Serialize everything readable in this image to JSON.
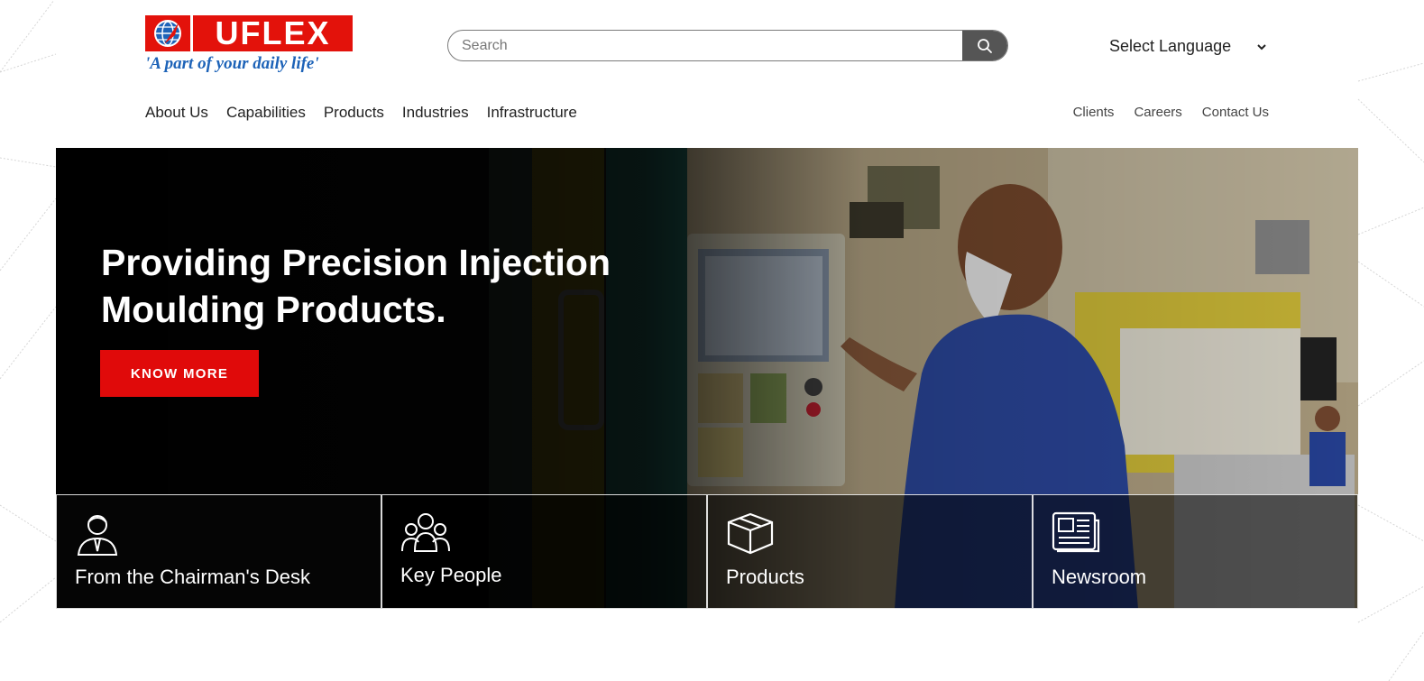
{
  "header": {
    "logo_text": "UFLEX",
    "logo_tagline": "'A part of your daily life'",
    "search_placeholder": "Search",
    "language_label": "Select Language",
    "language_chevron": "⌄"
  },
  "main_nav": [
    "About Us",
    "Capabilities",
    "Products",
    "Industries",
    "Infrastructure"
  ],
  "secondary_nav": [
    "Clients",
    "Careers",
    "Contact Us"
  ],
  "hero": {
    "title": "Providing Precision Injection Moulding Products.",
    "cta_label": "KNOW MORE"
  },
  "tiles": [
    {
      "label": "From the Chairman's Desk",
      "icon": "chairman-icon"
    },
    {
      "label": "Key People",
      "icon": "people-group-icon"
    },
    {
      "label": "Products",
      "icon": "box-icon"
    },
    {
      "label": "Newsroom",
      "icon": "newspaper-icon"
    }
  ],
  "colors": {
    "brand_red": "#e3120b",
    "cta_red": "#e00a0a",
    "tagline_blue": "#1d63b8",
    "search_button": "#555555"
  }
}
